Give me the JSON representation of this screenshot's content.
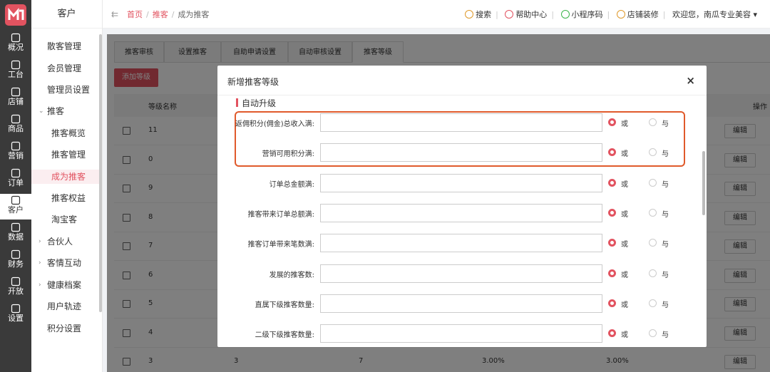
{
  "rail": {
    "items": [
      {
        "label": "概况",
        "icon": "chart-icon"
      },
      {
        "label": "工台",
        "icon": "monitor-icon"
      },
      {
        "label": "店铺",
        "icon": "store-icon"
      },
      {
        "label": "商品",
        "icon": "bag-icon"
      },
      {
        "label": "营销",
        "icon": "clover-icon"
      },
      {
        "label": "订单",
        "icon": "order-icon"
      },
      {
        "label": "客户",
        "icon": "user-icon"
      },
      {
        "label": "数据",
        "icon": "data-icon"
      },
      {
        "label": "财务",
        "icon": "finance-icon"
      },
      {
        "label": "开放",
        "icon": "code-icon"
      },
      {
        "label": "设置",
        "icon": "gear-icon"
      }
    ]
  },
  "submenu": {
    "title": "客户",
    "items": [
      {
        "label": "散客管理"
      },
      {
        "label": "会员管理"
      },
      {
        "label": "管理员设置"
      },
      {
        "label": "推客"
      },
      {
        "label": "推客概览"
      },
      {
        "label": "推客管理"
      },
      {
        "label": "成为推客"
      },
      {
        "label": "推客权益"
      },
      {
        "label": "淘宝客"
      },
      {
        "label": "合伙人"
      },
      {
        "label": "客情互动"
      },
      {
        "label": "健康档案"
      },
      {
        "label": "用户轨迹"
      },
      {
        "label": "积分设置"
      }
    ]
  },
  "breadcrumb": {
    "home": "首页",
    "section": "推客",
    "current": "成为推客"
  },
  "toolbar": {
    "search": "搜索",
    "help": "帮助中心",
    "miniapp": "小程序码",
    "decorate": "店铺装修",
    "welcome": "欢迎您，南瓜专业美容"
  },
  "tabs": [
    "推客审核",
    "设置推客",
    "自助申请设置",
    "自动审核设置",
    "推客等级"
  ],
  "add_button": "添加等级",
  "table": {
    "headers": {
      "level_name": "等级名称",
      "ops": "操作"
    },
    "edit_label": "编辑",
    "rows": [
      {
        "name": "11"
      },
      {
        "name": "0"
      },
      {
        "name": "9"
      },
      {
        "name": "8"
      },
      {
        "name": "7"
      },
      {
        "name": "6"
      },
      {
        "name": "5"
      },
      {
        "name": "4"
      },
      {
        "name": "3",
        "c2": "3",
        "c3": "7",
        "c4": "3.00%",
        "c5": "3.00%"
      }
    ]
  },
  "modal": {
    "title": "新增推客等级",
    "close": "×",
    "section": "自动升级",
    "or_label": "或",
    "and_label": "与",
    "fields": [
      {
        "label": "返佣积分(佣金)总收入满:",
        "value": ""
      },
      {
        "label": "营销可用积分满:",
        "value": ""
      },
      {
        "label": "订单总金额满:",
        "value": ""
      },
      {
        "label": "推客带来订单总额满:",
        "value": ""
      },
      {
        "label": "推客订单带来笔数满:",
        "value": ""
      },
      {
        "label": "发展的推客数:",
        "value": ""
      },
      {
        "label": "直属下级推客数量:",
        "value": ""
      },
      {
        "label": "二级下级推客数量:",
        "value": ""
      }
    ]
  },
  "colors": {
    "accent": "#e25360",
    "highlight": "#e05a2b"
  }
}
